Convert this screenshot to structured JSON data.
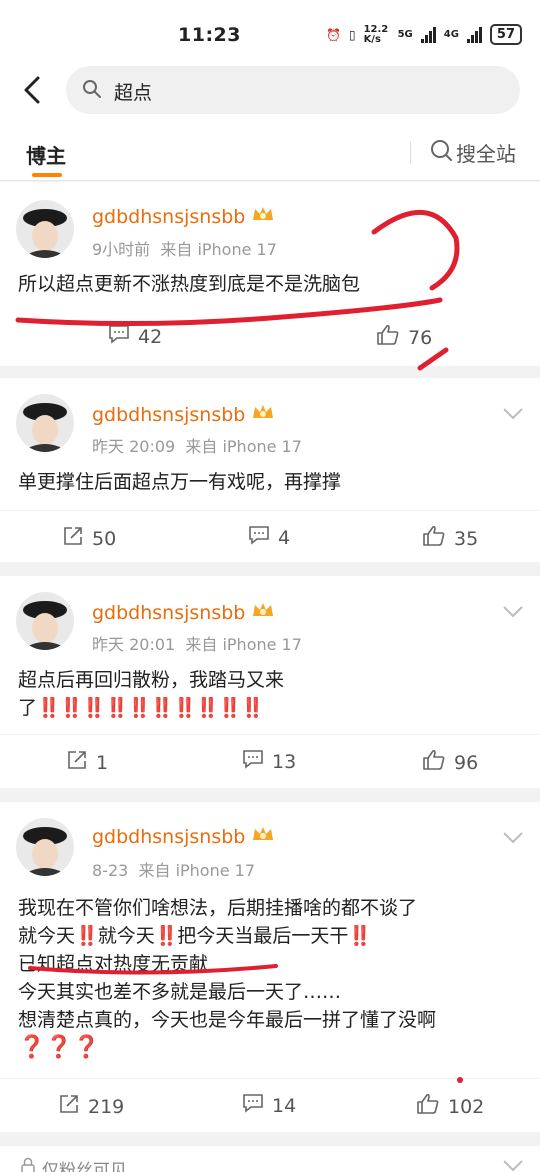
{
  "status_bar": {
    "time": "11:23",
    "net_speed": "12.2 K/s",
    "sig1": "5G",
    "sig2": "4G",
    "battery": "57"
  },
  "search": {
    "query": "超点"
  },
  "tabs": {
    "active": "博主",
    "all_site": "搜全站"
  },
  "posts": [
    {
      "username": "gdbdhsnsjsnsbb",
      "time": "9小时前",
      "source": "来自 iPhone 17",
      "text": "所以超点更新不涨热度到底是不是洗脑包",
      "comments": "42",
      "likes": "76"
    },
    {
      "username": "gdbdhsnsjsnsbb",
      "time": "昨天 20:09",
      "source": "来自 iPhone 17",
      "text": "单更撑住后面超点万一有戏呢，再撑撑",
      "reposts": "50",
      "comments": "4",
      "likes": "35"
    },
    {
      "username": "gdbdhsnsjsnsbb",
      "time": "昨天 20:01",
      "source": "来自 iPhone 17",
      "line1": "超点后再回归散粉，我踏马又来",
      "line2_prefix": "了",
      "line2_marks": "‼️‼️‼️‼️‼️‼️‼️‼️‼️‼️",
      "reposts": "1",
      "comments": "13",
      "likes": "96"
    },
    {
      "username": "gdbdhsnsjsnsbb",
      "time": "8-23",
      "source": "来自 iPhone 17",
      "line1": "我现在不管你们啥想法，后期挂播啥的都不谈了",
      "line2_a": "就今天",
      "line2_b": "就今天",
      "line2_c": "把今天当最后一天干",
      "mark": "‼️",
      "line3": "已知超点对热度无贡献",
      "line4": "今天其实也差不多就是最后一天了……",
      "line5": "想清楚点真的，今天也是今年最后一拼了懂了没啊",
      "line6": "❓❓❓",
      "reposts": "219",
      "comments": "14",
      "likes": "102"
    }
  ],
  "footer": {
    "visibility": "仅粉丝可见"
  },
  "colors": {
    "accent": "#ff8200",
    "username": "#e96d0d",
    "annotation": "#e02030"
  }
}
